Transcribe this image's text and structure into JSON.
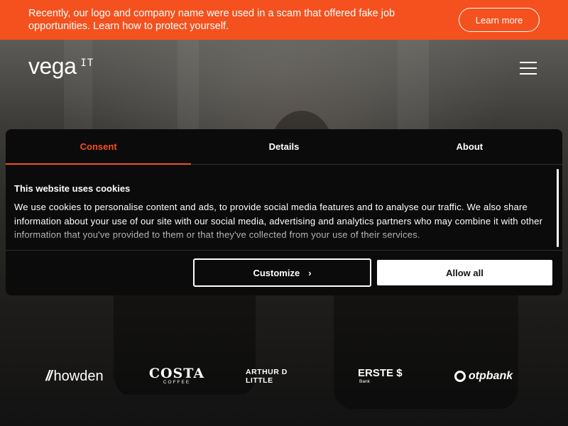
{
  "banner": {
    "text": "Recently, our logo and company name were used in a scam that offered fake job opportunities. Learn how to protect yourself.",
    "button_label": "Learn more",
    "color": "#f4511e"
  },
  "header": {
    "logo_main": "vega",
    "logo_suffix": "IT",
    "menu_icon": "hamburger-icon"
  },
  "cookie_dialog": {
    "tabs": [
      {
        "label": "Consent",
        "active": true
      },
      {
        "label": "Details",
        "active": false
      },
      {
        "label": "About",
        "active": false
      }
    ],
    "title": "This website uses cookies",
    "description": "We use cookies to personalise content and ads, to provide social media features and to analyse our traffic. We also share information about your use of our site with our social media, advertising and analytics partners who may combine it with other information that you've provided to them or that they've collected from your use of their services.",
    "customize_label": "Customize",
    "customize_icon": "chevron-right-icon",
    "allow_all_label": "Allow all",
    "accent_color": "#f4511e"
  },
  "clients": {
    "howden": {
      "mark": "//",
      "name": "howden"
    },
    "costa": {
      "name": "COSTA",
      "sub": "COFFEE"
    },
    "arthur": {
      "name": "ARTHUR D LITTLE"
    },
    "erste": {
      "name": "ERSTE",
      "symbol": "$",
      "sub": "Bank"
    },
    "otp": {
      "name": "otpbank"
    }
  }
}
